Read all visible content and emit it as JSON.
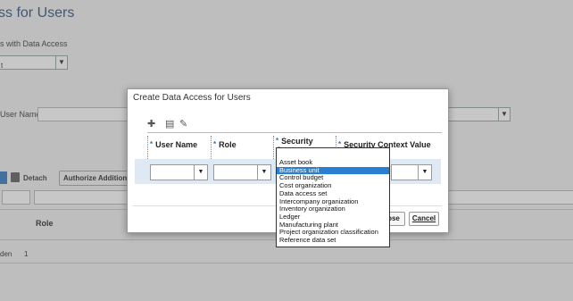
{
  "background": {
    "title": "ss for Users",
    "subtitle": "s with Data Access",
    "select_value": "t",
    "user_name_label": "User Name",
    "detach_label": "Detach",
    "authorize_label": "Authorize Additional",
    "role_header": "Role",
    "row_name": "den",
    "row_value": "1"
  },
  "dialog": {
    "title": "Create Data Access for Users",
    "columns": [
      {
        "label": "User Name",
        "required": "*"
      },
      {
        "label": "Role",
        "required": "*"
      },
      {
        "label": "Security Context",
        "required": "*"
      },
      {
        "label": "Security Context Value",
        "required": "*"
      }
    ],
    "buttons": {
      "save_close": "ose",
      "cancel": "Cancel"
    }
  },
  "dropdown": {
    "selected": "Business unit",
    "options": [
      "Asset book",
      "Business unit",
      "Control budget",
      "Cost organization",
      "Data access set",
      "Intercompany organization",
      "Inventory organization",
      "Ledger",
      "Manufacturing plant",
      "Project organization classification",
      "Reference data set"
    ]
  },
  "colors": {
    "accent": "#2a7fd0",
    "row_band": "#dfe9f4",
    "title": "#3a5a80"
  }
}
